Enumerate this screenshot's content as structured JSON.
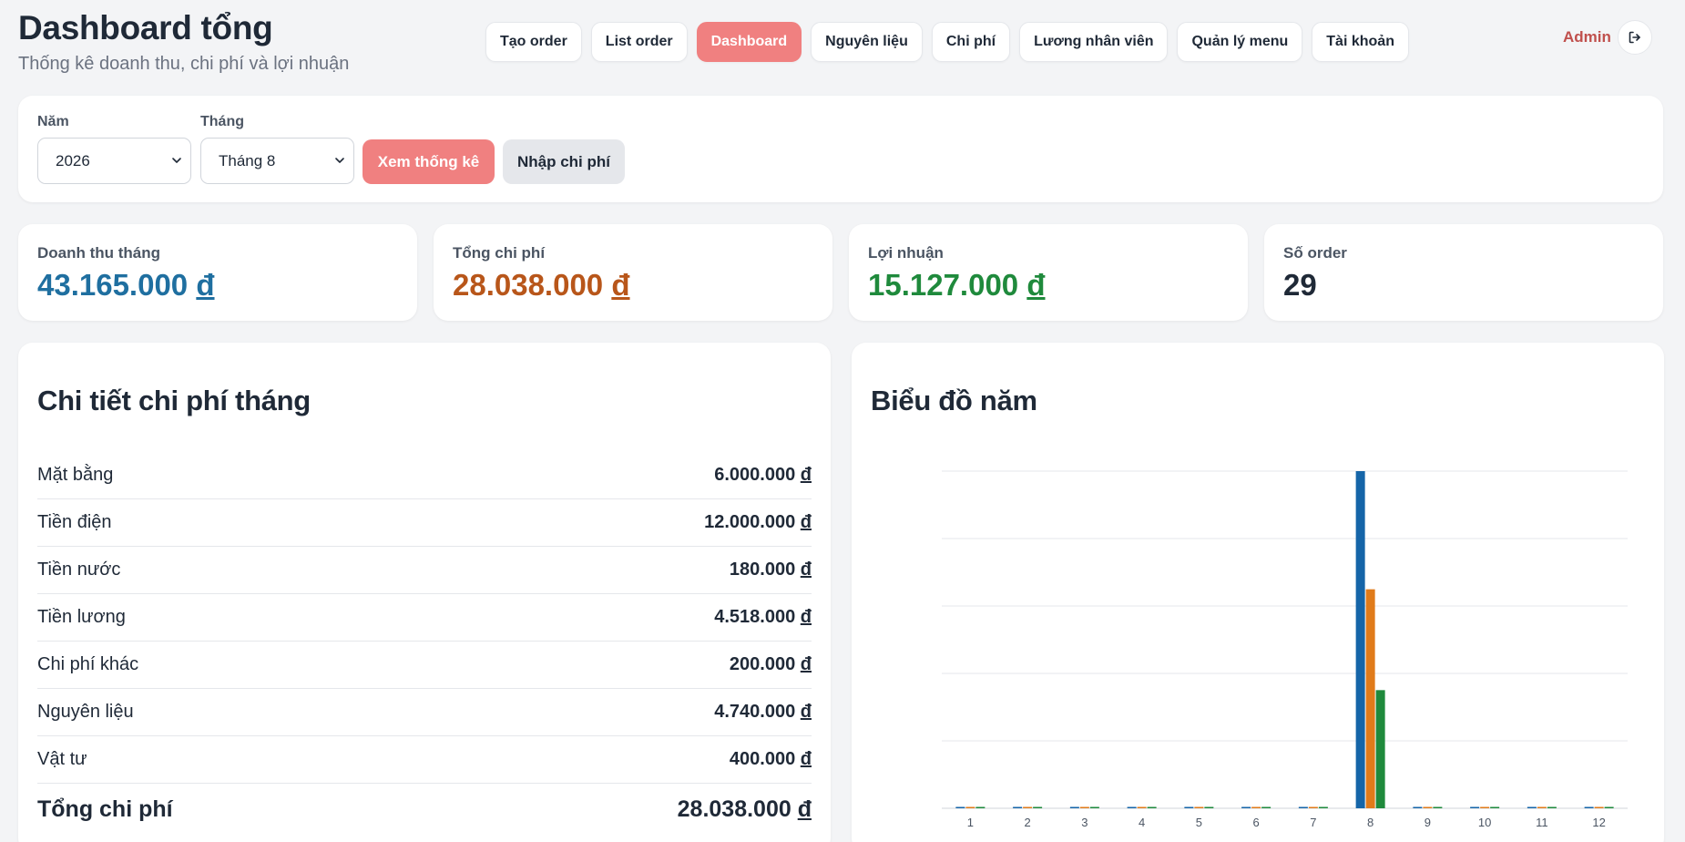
{
  "header": {
    "title": "Dashboard tổng",
    "subtitle": "Thống kê doanh thu, chi phí và lợi nhuận",
    "user": "Admin",
    "logout_icon": "logout-icon"
  },
  "nav": [
    {
      "label": "Tạo order",
      "active": false
    },
    {
      "label": "List order",
      "active": false
    },
    {
      "label": "Dashboard",
      "active": true
    },
    {
      "label": "Nguyên liệu",
      "active": false
    },
    {
      "label": "Chi phí",
      "active": false
    },
    {
      "label": "Lương nhân viên",
      "active": false
    },
    {
      "label": "Quản lý menu",
      "active": false
    },
    {
      "label": "Tài khoản",
      "active": false
    }
  ],
  "filters": {
    "year_label": "Năm",
    "year_value": "2026",
    "month_label": "Tháng",
    "month_value": "Tháng 8",
    "view_button": "Xem thống kê",
    "input_button": "Nhập chi phí"
  },
  "stats": [
    {
      "label": "Doanh thu tháng",
      "value": "43.165.000",
      "currency": "đ",
      "color": "#1f6fa0"
    },
    {
      "label": "Tổng chi phí",
      "value": "28.038.000",
      "currency": "đ",
      "color": "#b8561a"
    },
    {
      "label": "Lợi nhuận",
      "value": "15.127.000",
      "currency": "đ",
      "color": "#1f8a3c"
    },
    {
      "label": "Số order",
      "value": "29",
      "currency": "",
      "color": "#1f2937"
    }
  ],
  "cost_detail": {
    "title": "Chi tiết chi phí tháng",
    "currency": "đ",
    "rows": [
      {
        "name": "Mặt bằng",
        "value": "6.000.000"
      },
      {
        "name": "Tiền điện",
        "value": "12.000.000"
      },
      {
        "name": "Tiền nước",
        "value": "180.000"
      },
      {
        "name": "Tiền lương",
        "value": "4.518.000"
      },
      {
        "name": "Chi phí khác",
        "value": "200.000"
      },
      {
        "name": "Nguyên liệu",
        "value": "4.740.000"
      },
      {
        "name": "Vật tư",
        "value": "400.000"
      }
    ],
    "total": {
      "name": "Tổng chi phí",
      "value": "28.038.000"
    }
  },
  "chart_data": {
    "type": "bar",
    "title": "Biểu đồ năm",
    "categories": [
      "1",
      "2",
      "3",
      "4",
      "5",
      "6",
      "7",
      "8",
      "9",
      "10",
      "11",
      "12"
    ],
    "series": [
      {
        "values": [
          0,
          0,
          0,
          0,
          0,
          0,
          0,
          43165000,
          0,
          0,
          0,
          0
        ],
        "color": "#1565a8"
      },
      {
        "values": [
          0,
          0,
          0,
          0,
          0,
          0,
          0,
          28038000,
          0,
          0,
          0,
          0
        ],
        "color": "#e07b1a"
      },
      {
        "values": [
          0,
          0,
          0,
          0,
          0,
          0,
          0,
          15127000,
          0,
          0,
          0,
          0
        ],
        "color": "#1f8a3c"
      }
    ],
    "ylim": [
      0,
      43165000
    ],
    "grid": true,
    "y_tick_labels_visible": false
  }
}
